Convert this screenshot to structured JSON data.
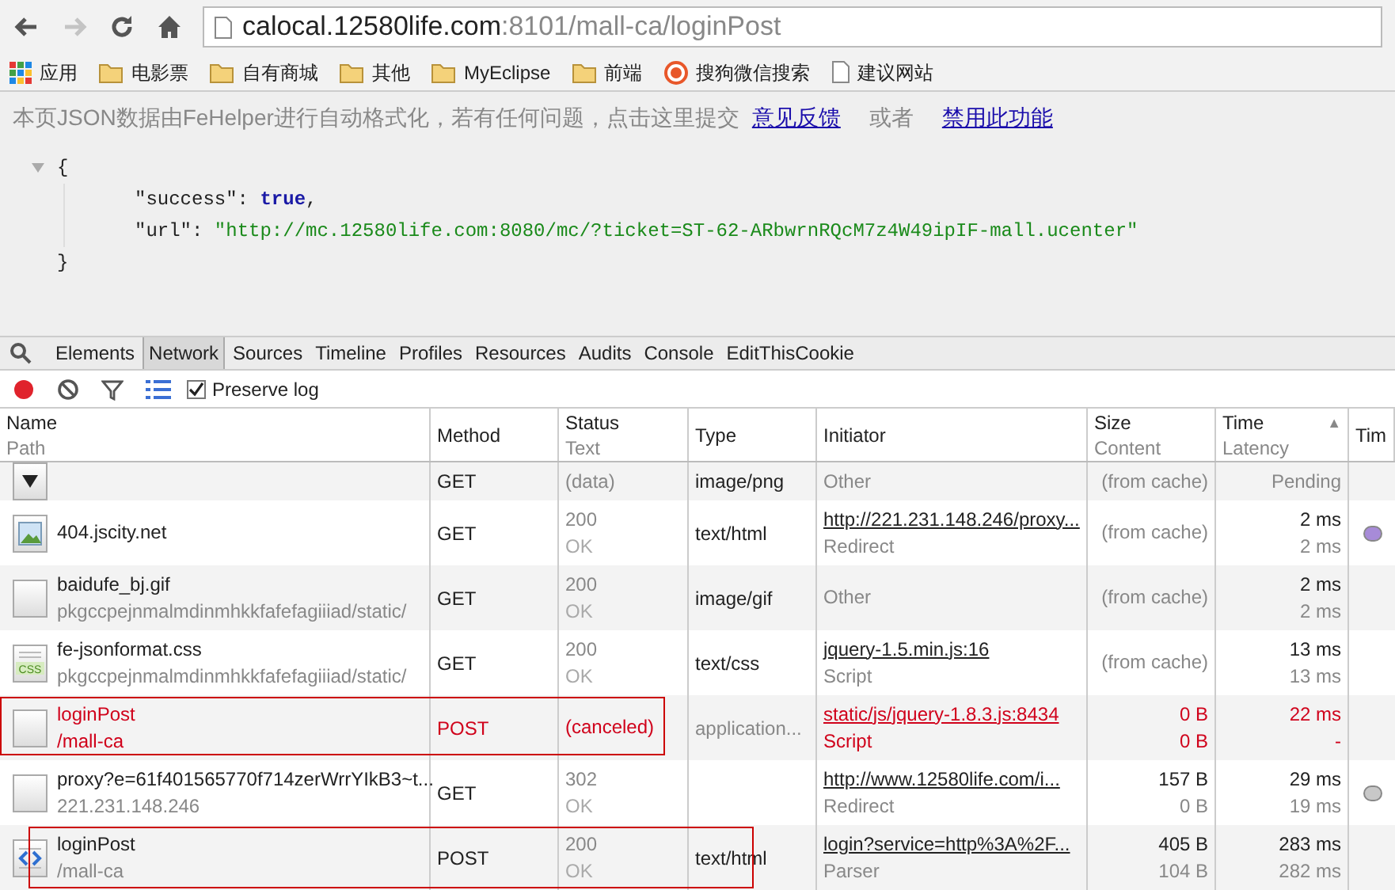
{
  "browser": {
    "nav": [
      {
        "kind": "back",
        "disabled": false
      },
      {
        "kind": "forward",
        "disabled": true
      },
      {
        "kind": "reload",
        "disabled": false
      },
      {
        "kind": "home",
        "disabled": false
      }
    ],
    "url_host": "calocal.12580life.com",
    "url_rest": ":8101/mall-ca/loginPost"
  },
  "bookmarks": [
    {
      "kind": "apps",
      "label": "应用"
    },
    {
      "kind": "folder",
      "label": "电影票"
    },
    {
      "kind": "folder",
      "label": "自有商城"
    },
    {
      "kind": "folder",
      "label": "其他"
    },
    {
      "kind": "folder",
      "label": "MyEclipse"
    },
    {
      "kind": "folder",
      "label": "前端"
    },
    {
      "kind": "sogou",
      "label": "搜狗微信搜索"
    },
    {
      "kind": "page",
      "label": "建议网站"
    }
  ],
  "notice": {
    "text": "本页JSON数据由FeHelper进行自动格式化，若有任何问题，点击这里提交",
    "link1": "意见反馈",
    "middle": "或者",
    "link2": "禁用此功能"
  },
  "json_view": {
    "open": "{",
    "close": "}",
    "entries": [
      {
        "key": "\"success\":",
        "value": "true",
        "kind": "bool",
        "comma": ","
      },
      {
        "key": "\"url\":",
        "value": "\"http://mc.12580life.com:8080/mc/?ticket=ST-62-ARbwrnRQcM7z4W49ipIF-mall.ucenter\"",
        "kind": "string"
      }
    ]
  },
  "devtools": {
    "tabs": [
      {
        "label": "Elements",
        "selected": false
      },
      {
        "label": "Network",
        "selected": true
      },
      {
        "label": "Sources",
        "selected": false
      },
      {
        "label": "Timeline",
        "selected": false
      },
      {
        "label": "Profiles",
        "selected": false
      },
      {
        "label": "Resources",
        "selected": false
      },
      {
        "label": "Audits",
        "selected": false
      },
      {
        "label": "Console",
        "selected": false
      },
      {
        "label": "EditThisCookie",
        "selected": false
      }
    ],
    "recording": true,
    "preserve_log": {
      "label": "Preserve log",
      "checked": true
    }
  },
  "table": {
    "columns": [
      {
        "title": "Name",
        "sub": "Path"
      },
      {
        "title": "Method"
      },
      {
        "title": "Status",
        "sub": "Text"
      },
      {
        "title": "Type"
      },
      {
        "title": "Initiator"
      },
      {
        "title": "Size",
        "sub": "Content"
      },
      {
        "title": "Time",
        "sub": "Latency",
        "sort": "▲"
      },
      {
        "title": "Tim"
      }
    ],
    "rows": [
      {
        "kind": "arrow",
        "partial": true,
        "method": "GET",
        "status": "(data)",
        "type": "image/png",
        "initiator": "Other",
        "initiator_link": false,
        "size": "(from cache)",
        "time": "Pending",
        "failed": false,
        "highlighted": false
      },
      {
        "kind": "image",
        "partial": false,
        "name": "404.jscity.net",
        "method": "GET",
        "status": "200",
        "status_text": "OK",
        "type": "text/html",
        "initiator": "http://221.231.148.246/proxy...",
        "initiator_link": true,
        "initiator_note": "Redirect",
        "size": "(from cache)",
        "time": "2 ms",
        "latency": "2 ms",
        "failed": false,
        "highlighted": false,
        "color": "#a78bd8"
      },
      {
        "kind": "blank",
        "partial": false,
        "name": "baidufe_bj.gif",
        "path": "pkgccpejnmalmdinmhkkfafefagiiiad/static/",
        "method": "GET",
        "status": "200",
        "status_text": "OK",
        "type": "image/gif",
        "initiator": "Other",
        "initiator_link": false,
        "size": "(from cache)",
        "time": "2 ms",
        "latency": "2 ms",
        "failed": false,
        "highlighted": false
      },
      {
        "kind": "css",
        "badge": "CSS",
        "partial": false,
        "name": "fe-jsonformat.css",
        "path": "pkgccpejnmalmdinmhkkfafefagiiiad/static/",
        "method": "GET",
        "status": "200",
        "status_text": "OK",
        "type": "text/css",
        "initiator": "jquery-1.5.min.js:16",
        "initiator_link": true,
        "initiator_note": "Script",
        "size": "(from cache)",
        "time": "13 ms",
        "latency": "13 ms",
        "failed": false,
        "highlighted": false
      },
      {
        "kind": "blank",
        "partial": false,
        "name": "loginPost",
        "path": "/mall-ca",
        "method": "POST",
        "status": "(canceled)",
        "type": "application...",
        "initiator": "static/js/jquery-1.8.3.js:8434",
        "initiator_link": true,
        "initiator_note": "Script",
        "size": "0 B",
        "content": "0 B",
        "time": "22 ms",
        "latency": "-",
        "failed": true,
        "highlighted": true
      },
      {
        "kind": "blank",
        "partial": false,
        "name": "proxy?e=61f401565770f714zerWrrYIkB3~t...",
        "path": "221.231.148.246",
        "method": "GET",
        "status": "302",
        "status_text": "OK",
        "initiator": "http://www.12580life.com/i...",
        "initiator_link": true,
        "initiator_note": "Redirect",
        "size": "157 B",
        "content": "0 B",
        "time": "29 ms",
        "latency": "19 ms",
        "failed": false,
        "highlighted": false,
        "color": "#c8c8c8"
      },
      {
        "kind": "html",
        "partial": false,
        "name": "loginPost",
        "path": "/mall-ca",
        "method": "POST",
        "status": "200",
        "status_text": "OK",
        "type": "text/html",
        "initiator": "login?service=http%3A%2F...",
        "initiator_link": true,
        "initiator_note": "Parser",
        "size": "405 B",
        "content": "104 B",
        "time": "283 ms",
        "latency": "282 ms",
        "failed": false,
        "highlighted": true
      }
    ]
  }
}
